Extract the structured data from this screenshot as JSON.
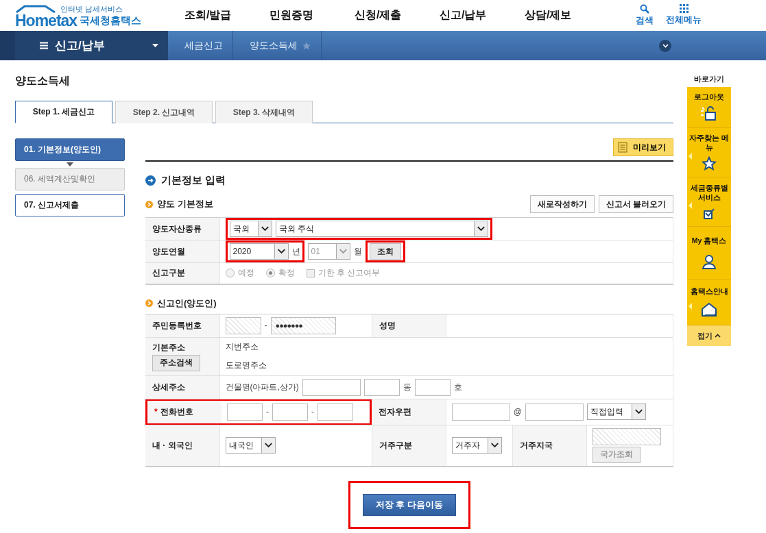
{
  "header": {
    "logo": {
      "tagline": "인터넷 납세서비스",
      "brand": "Hometax",
      "name": "국세청홈택스"
    },
    "menu": [
      "조회/발급",
      "민원증명",
      "신청/제출",
      "신고/납부",
      "상담/제보"
    ],
    "tools": [
      {
        "label": "검색",
        "kind": "search"
      },
      {
        "label": "전체메뉴",
        "kind": "grid"
      }
    ]
  },
  "nav": {
    "menu": "신고/납부",
    "crumbs": [
      {
        "label": "세금신고",
        "starred": false
      },
      {
        "label": "양도소득세",
        "starred": true
      }
    ]
  },
  "page_title": "양도소득세",
  "tabs": [
    {
      "label": "Step 1. 세금신고",
      "selected": true
    },
    {
      "label": "Step 2. 신고내역",
      "selected": false
    },
    {
      "label": "Step 3. 삭제내역",
      "selected": false
    }
  ],
  "steps": [
    {
      "label": "01. 기본정보(양도인)",
      "kind": "active"
    },
    {
      "label": "06. 세액계산및확인",
      "kind": "disabled"
    },
    {
      "label": "07. 신고서제출",
      "kind": "normal"
    }
  ],
  "preview_button": "미리보기",
  "section_title": "기본정보 입력",
  "transfer": {
    "title": "양도 기본정보",
    "buttons": [
      "새로작성하기",
      "신고서 불러오기"
    ],
    "rows": [
      {
        "label": "양도자산종류",
        "controls": [
          {
            "kind": "group",
            "highlighted": true,
            "controls": [
              {
                "kind": "select",
                "value": "국외",
                "disabled": false
              },
              {
                "kind": "select",
                "value": "국외 주식",
                "disabled": false,
                "wide": true
              }
            ]
          }
        ]
      },
      {
        "label": "양도연월",
        "controls": [
          {
            "kind": "group",
            "highlighted": true,
            "controls": [
              {
                "kind": "select",
                "value": "2020",
                "disabled": false
              },
              {
                "kind": "text",
                "value": "년"
              }
            ]
          },
          {
            "kind": "select",
            "value": "01",
            "disabled": true
          },
          {
            "kind": "text",
            "value": "월"
          },
          {
            "kind": "group",
            "highlighted": true,
            "controls": [
              {
                "kind": "button",
                "value": "조회",
                "disabled": false
              }
            ]
          }
        ]
      },
      {
        "label": "신고구분",
        "controls": [
          {
            "kind": "radio",
            "value": "예정",
            "selected": false,
            "disabled": true
          },
          {
            "kind": "radio",
            "value": "확정",
            "selected": true,
            "disabled": true
          },
          {
            "kind": "checkbox",
            "value": "기한 후 신고여부",
            "checked": false,
            "disabled": true
          }
        ]
      }
    ]
  },
  "reporter": {
    "title": "신고인(양도인)",
    "rows": [
      {
        "pairs": [
          {
            "label": "주민등록번호",
            "controls": [
              {
                "kind": "input",
                "readonly": true
              },
              {
                "kind": "text",
                "value": "-"
              },
              {
                "kind": "input",
                "value": "●●●●●●●",
                "readonly": true
              }
            ]
          },
          {
            "label": "성명"
          }
        ]
      },
      {
        "pairs": [
          {
            "label": "기본주소",
            "button": "주소검색",
            "controls": [
              {
                "kind": "line",
                "value": "지번주소"
              },
              {
                "kind": "line",
                "value": "도로명주소"
              }
            ]
          }
        ]
      },
      {
        "pairs": [
          {
            "label": "상세주소",
            "controls": [
              {
                "kind": "text",
                "value": "건물명(아파트,상가)"
              },
              {
                "kind": "input",
                "readonly": false,
                "wide": true
              },
              {
                "kind": "input",
                "readonly": false
              },
              {
                "kind": "text",
                "value": "동"
              },
              {
                "kind": "input",
                "readonly": false
              },
              {
                "kind": "text",
                "value": "호"
              }
            ]
          }
        ]
      },
      {
        "pairs": [
          {
            "label": "전화번호",
            "required_mark": "*",
            "highlighted": true,
            "controls": [
              {
                "kind": "input",
                "readonly": false
              },
              {
                "kind": "text",
                "value": "-"
              },
              {
                "kind": "input",
                "readonly": false
              },
              {
                "kind": "text",
                "value": "-"
              },
              {
                "kind": "input",
                "readonly": false
              }
            ]
          },
          {
            "label": "전자우편",
            "controls": [
              {
                "kind": "input",
                "readonly": false,
                "wide": true
              },
              {
                "kind": "text",
                "value": "@"
              },
              {
                "kind": "input",
                "readonly": false,
                "wide": true
              },
              {
                "kind": "select",
                "value": "직접입력",
                "disabled": false
              }
            ]
          }
        ]
      },
      {
        "pairs": [
          {
            "label": "내 · 외국인",
            "controls": [
              {
                "kind": "select",
                "value": "내국인",
                "disabled": false
              }
            ]
          },
          {
            "label": "거주구분",
            "controls": [
              {
                "kind": "select",
                "value": "거주자",
                "disabled": false
              }
            ]
          },
          {
            "label": "거주지국",
            "controls": [
              {
                "kind": "stack",
                "controls": [
                  {
                    "kind": "input",
                    "readonly": true,
                    "wide": true
                  },
                  {
                    "kind": "button",
                    "value": "국가조회",
                    "disabled": true
                  }
                ]
              }
            ]
          }
        ]
      }
    ]
  },
  "submit": {
    "label": "저장 후 다음이동",
    "highlighted": true
  },
  "quick": {
    "title": "바로가기",
    "items": [
      {
        "label": "로그아웃",
        "kind": "lock",
        "pointer": false
      },
      {
        "label": "자주찾는 메뉴",
        "kind": "star",
        "pointer": true
      },
      {
        "label": "세금종류별 서비스",
        "kind": "check",
        "pointer": true
      },
      {
        "label": "My 홈택스",
        "kind": "user",
        "pointer": false
      },
      {
        "label": "홈택스안내",
        "kind": "home",
        "pointer": true
      }
    ],
    "collapse": "접기"
  }
}
